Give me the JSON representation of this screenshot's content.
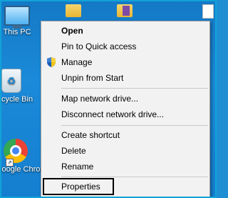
{
  "desktop": {
    "icons": [
      {
        "label": "This PC",
        "icon": "this-pc-icon"
      },
      {
        "label": "Recycle Bin",
        "icon": "recycle-bin-icon"
      },
      {
        "label": "Google Chrome",
        "icon": "chrome-icon"
      }
    ]
  },
  "context_menu": {
    "items": [
      {
        "label": "Open",
        "bold": true
      },
      {
        "label": "Pin to Quick access"
      },
      {
        "label": "Manage",
        "icon": "shield-icon"
      },
      {
        "label": "Unpin from Start"
      },
      {
        "label": "Map network drive..."
      },
      {
        "label": "Disconnect network drive..."
      },
      {
        "label": "Create shortcut"
      },
      {
        "label": "Delete"
      },
      {
        "label": "Rename"
      },
      {
        "label": "Properties",
        "highlighted": true
      }
    ]
  },
  "colors": {
    "desktop_bg": "#1479c6",
    "frame_border": "#11a2d8",
    "menu_bg": "#f2f2f2",
    "highlight_border": "#000000"
  }
}
